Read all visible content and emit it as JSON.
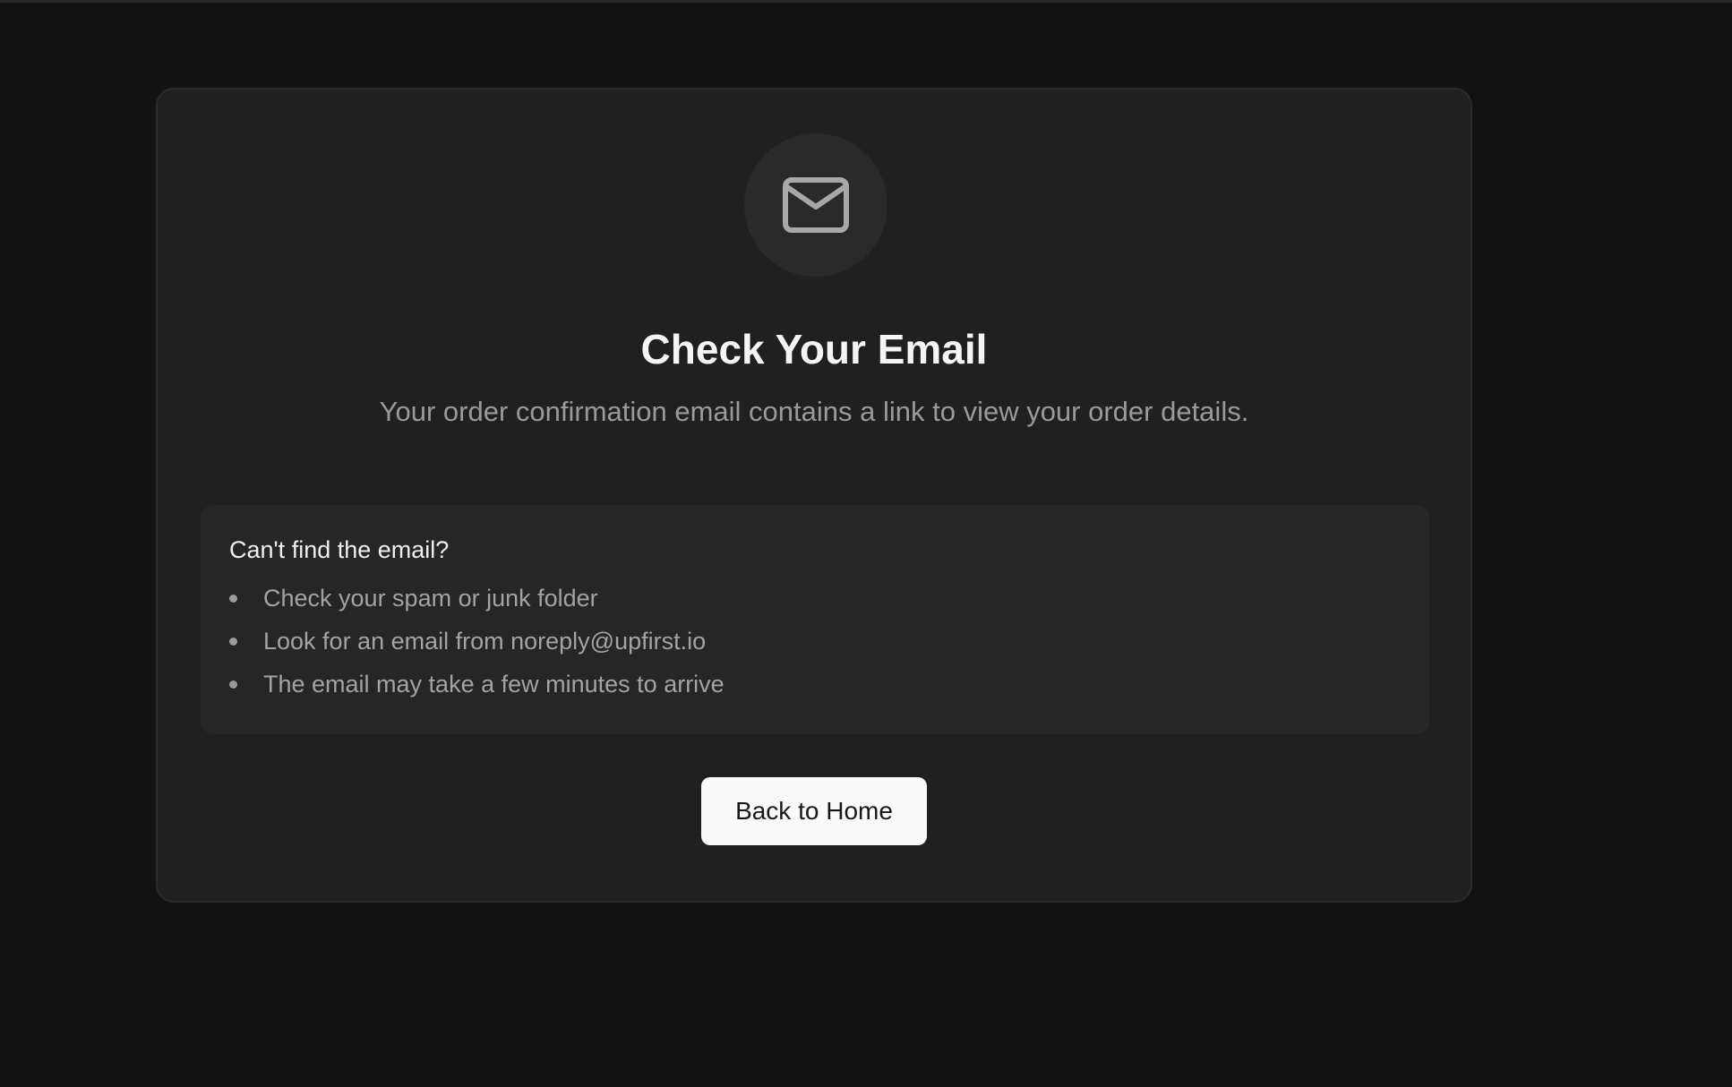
{
  "card": {
    "icon": "mail-icon",
    "title": "Check Your Email",
    "subtitle": "Your order confirmation email contains a link to view your order details."
  },
  "help": {
    "title": "Can't find the email?",
    "items": [
      "Check your spam or junk folder",
      "Look for an email from noreply@upfirst.io",
      "The email may take a few minutes to arrive"
    ]
  },
  "actions": {
    "back_home_label": "Back to Home"
  },
  "colors": {
    "background": "#121212",
    "card": "#202020",
    "button": "#fafafa"
  }
}
